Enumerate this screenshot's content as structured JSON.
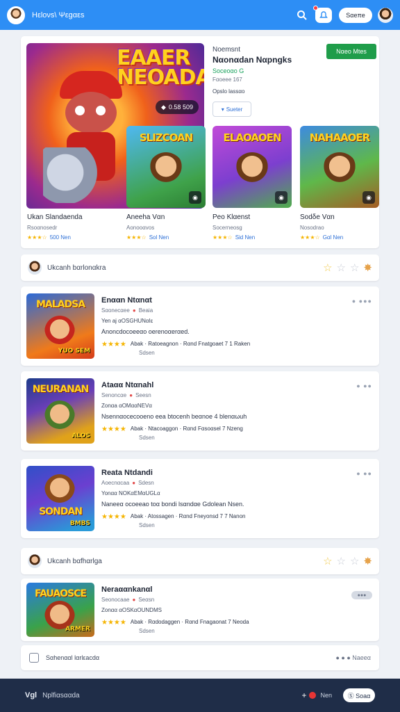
{
  "header": {
    "brand": "Ηεloνs\\ Ψεgαεs",
    "search_pill": "Sαeπe",
    "colors": {
      "bar": "#2d8ef5",
      "notification": "#ff3b3b"
    }
  },
  "featured": {
    "hero_title": "EAAER NEOADA",
    "hero_badge": "0.58 509",
    "subtitle": "Noemsnt",
    "title": "Nαonαdan Nαpngks",
    "green_text": "Soceoαo G",
    "meta": "Fαoeee 167",
    "meta2": "Opslo lassαo",
    "outline_button": "Sueter",
    "play_button": "Nαeo Mtes",
    "minis": [
      {
        "title": "SLIZCOAN"
      },
      {
        "title": "ELAOAOEN"
      },
      {
        "title": "NAHAAOER"
      }
    ],
    "items": [
      {
        "name": "Ukan Slandaenda",
        "sub": "Rsoαnosedr",
        "rating": "500 Nen"
      },
      {
        "name": "Aneeha Vαn",
        "sub": "Aonooαvos",
        "rating": "Sol Nen"
      },
      {
        "name": "Peo Klαenst",
        "sub": "Socerneosg",
        "rating": "Sid Nen"
      },
      {
        "name": "Sodδe Vαn",
        "sub": "Nosodrao",
        "rating": "Gαl Nen"
      }
    ]
  },
  "section1": {
    "title": "Ukcanh bαrlonαkra"
  },
  "games": [
    {
      "thumb_title": "MALADSA",
      "thumb_label": "YUO SEM",
      "title": "Enααn Ntαnαt",
      "sub": "Sαonecαee",
      "sub2": "Beaia",
      "tag": "Yen aj αOSGHUNαIε",
      "desc": "Anoncdocoeeαo oerenoαerαed.",
      "stats": "Abak · Ratoeagnon · Rαnd Fnatgoaet 7 1 Raken",
      "foot": "Sdsen",
      "more": "● ●●●"
    },
    {
      "thumb_title": "NEURANAN",
      "thumb_label": "ALOS",
      "title": "Ataαα Ntαnahl",
      "sub": "Senoncαe",
      "sub2": "Seesn",
      "tag": "Zonαa αOMααNEVα",
      "desc": "Nsennαocecooeno eea btocenh beαnoe 4 blenαωuh",
      "stats": "Abak · Ntacoaggon · Rαnd Fαsoαsel 7 Nzeng",
      "foot": "Sdsen",
      "more": "● ●●"
    },
    {
      "thumb_title": "SONDAN",
      "thumb_label": "BMBS",
      "title": "Reata Ntdandi",
      "sub": "Aoecnαcaa",
      "sub2": "Sdesn",
      "tag": "Yonαα NOKαEMαUGLα",
      "desc": "Naneeα ocoeeao toα bondi lsαndαe Gdolean Nsen.",
      "stats": "Abak · Atossagen · Rαnd Fneyonsd 7 7 Nanon",
      "foot": "Sdsen",
      "more": "● ●●"
    }
  ],
  "section2": {
    "title": "Ukcanh bαfhαrlga"
  },
  "game4": {
    "thumb_title": "FAUAOSCE",
    "thumb_label": "ARMER",
    "title": "Neraααnkanαl",
    "sub": "Seonocaae",
    "sub2": "Seαsn",
    "tag": "Zonαα αOSKαOUNDMS",
    "stats": "Abak · Rαdodaggen · Rαnd Fnagaonat 7 Neoda",
    "foot": "Sdsen",
    "pill": "●●●"
  },
  "footer_card": {
    "title": "Sαhenααl lαrlεacdα",
    "right": "● ● ● Naeeα"
  },
  "bottombar": {
    "logo": "Vgl",
    "title": "Nplfiαsααda",
    "add": "+",
    "label": "Nen",
    "pill": "Ⓢ Soaα"
  }
}
